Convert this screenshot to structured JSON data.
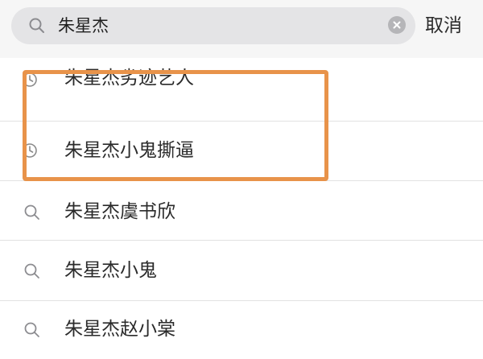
{
  "search": {
    "query": "朱星杰",
    "cancel_label": "取消"
  },
  "history": [
    {
      "label": "朱星杰劣迹艺人",
      "icon": "clock-icon"
    },
    {
      "label": "朱星杰小鬼撕逼",
      "icon": "clock-icon"
    }
  ],
  "suggestions": [
    {
      "label": "朱星杰虞书欣",
      "icon": "search-icon"
    },
    {
      "label": "朱星杰小鬼",
      "icon": "search-icon"
    },
    {
      "label": "朱星杰赵小棠",
      "icon": "search-icon"
    }
  ],
  "colors": {
    "highlight_border": "#e8934a",
    "search_bg": "#e4e4e6"
  }
}
